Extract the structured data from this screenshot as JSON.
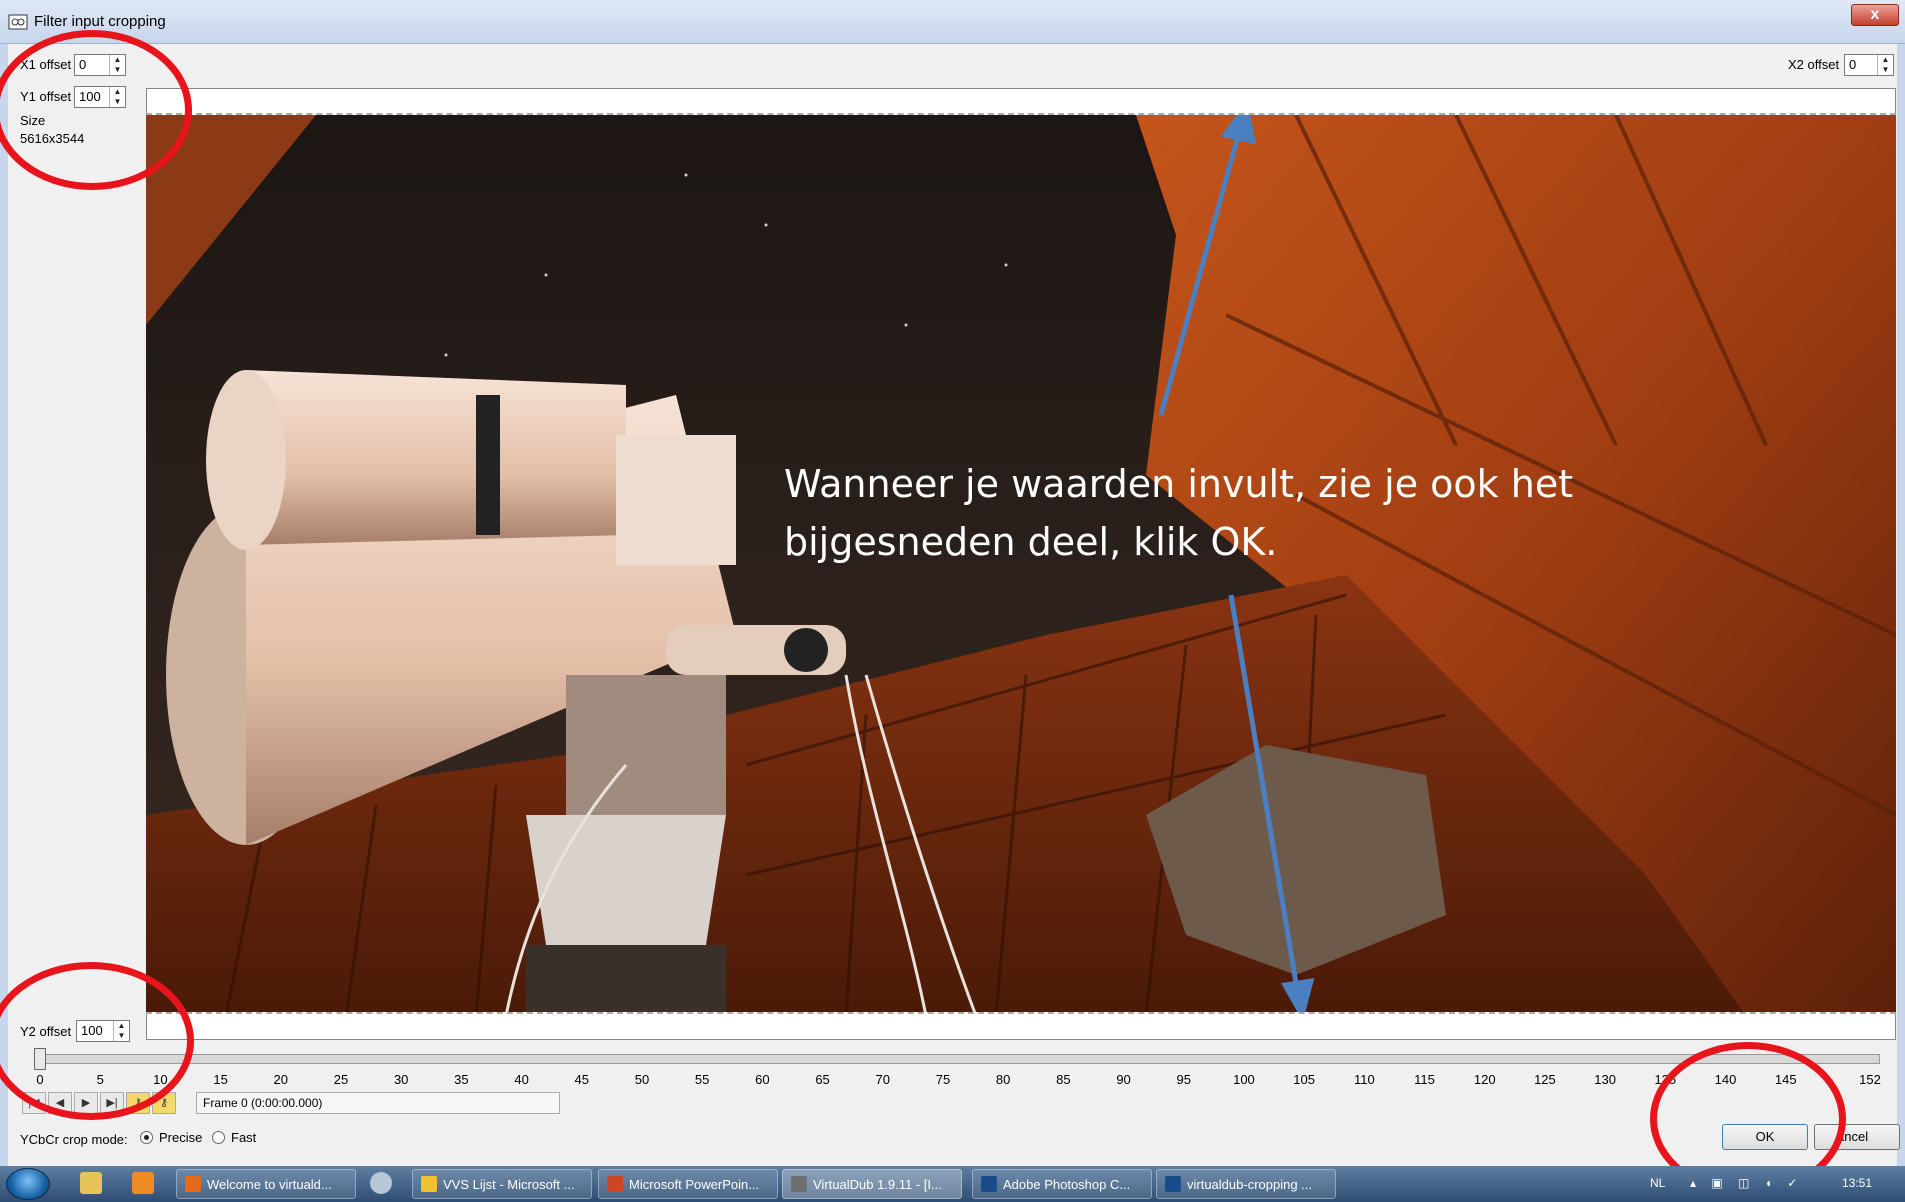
{
  "window": {
    "title": "Filter input cropping",
    "close_label": "x"
  },
  "fields": {
    "x1": {
      "label": "X1 offset",
      "value": "0"
    },
    "y1": {
      "label": "Y1 offset",
      "value": "100"
    },
    "size_label": "Size",
    "size_value": "5616x3544",
    "x2": {
      "label": "X2 offset",
      "value": "0"
    },
    "y2": {
      "label": "Y2 offset",
      "value": "100"
    }
  },
  "overlay": {
    "line1": "Wanneer je waarden invult, zie je ook het",
    "line2": "bijgesneden deel, klik OK."
  },
  "timeline": {
    "ticks": [
      "0",
      "5",
      "10",
      "15",
      "20",
      "25",
      "30",
      "35",
      "40",
      "45",
      "50",
      "55",
      "60",
      "65",
      "70",
      "75",
      "80",
      "85",
      "90",
      "95",
      "100",
      "105",
      "110",
      "115",
      "120",
      "125",
      "130",
      "135",
      "140",
      "145",
      "152"
    ],
    "position": 0
  },
  "frame_display": "Frame 0 (0:00:00.000)",
  "crop_mode": {
    "label": "YCbCr crop mode:",
    "options": [
      "Precise",
      "Fast"
    ],
    "selected": "Precise"
  },
  "buttons": {
    "ok": "OK",
    "cancel": "ancel"
  },
  "taskbar": {
    "tasks": [
      {
        "label": "Welcome to virtuald...",
        "color": "#e26a1b"
      },
      {
        "label": "VVS Lijst - Microsoft ...",
        "color": "#f2c230"
      },
      {
        "label": "Microsoft PowerPoin...",
        "color": "#d04423"
      },
      {
        "label": "VirtualDub 1.9.11 - [I...",
        "color": "#6f6f6f"
      },
      {
        "label": "Adobe Photoshop C...",
        "color": "#1a4c8b"
      },
      {
        "label": "virtualdub-cropping ...",
        "color": "#1a4c8b"
      }
    ],
    "language": "NL",
    "clock": "13:51"
  }
}
